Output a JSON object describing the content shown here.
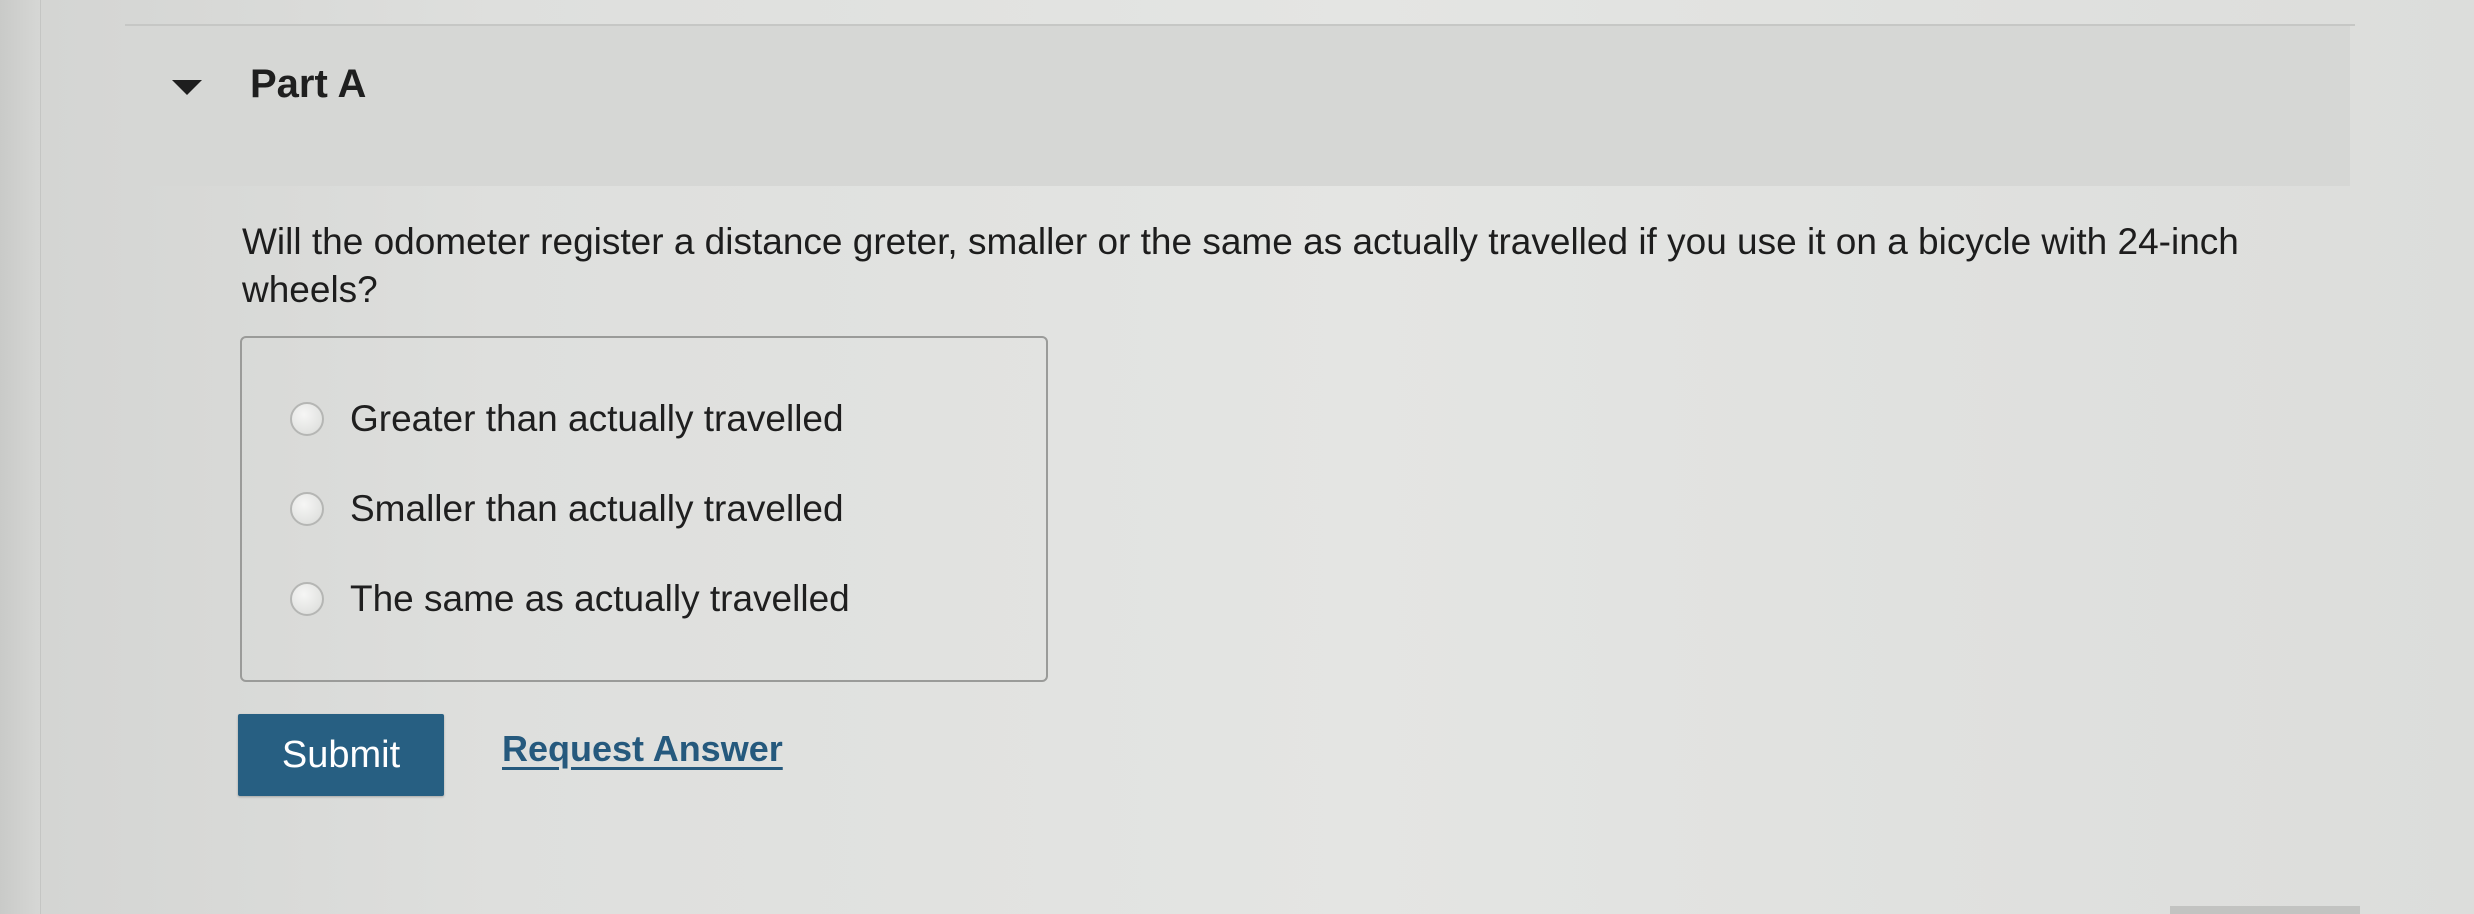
{
  "part": {
    "title": "Part A",
    "expanded": true,
    "toggle_icon": "caret-down-icon"
  },
  "question": {
    "text": "Will the odometer register a distance greter, smaller or the same as actually travelled if you use it on a bicycle with 24-inch wheels?"
  },
  "choices": [
    {
      "label": "Greater than actually travelled",
      "selected": false
    },
    {
      "label": "Smaller than actually travelled",
      "selected": false
    },
    {
      "label": "The same as actually travelled",
      "selected": false
    }
  ],
  "actions": {
    "submit_label": "Submit",
    "request_answer_label": "Request Answer"
  },
  "colors": {
    "submit_background": "#275f82",
    "link": "#25597d",
    "header_band": "#d6d7d5"
  }
}
